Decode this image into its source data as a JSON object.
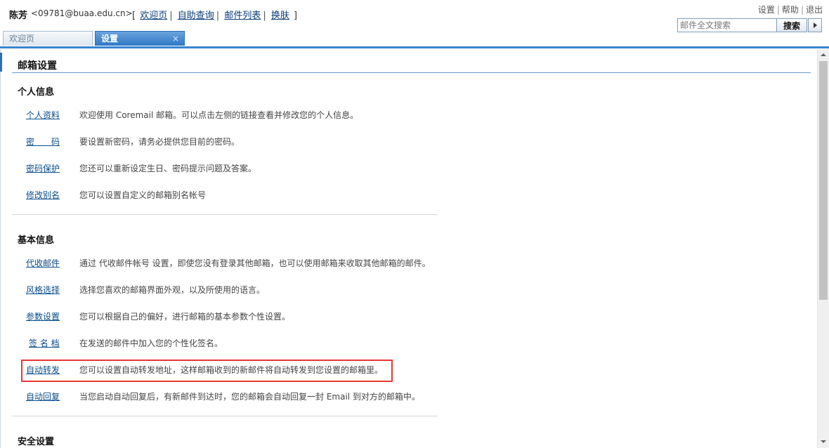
{
  "header": {
    "user_name": "陈芳",
    "user_email": "<09781@buaa.edu.cn>",
    "nav_open": "[",
    "nav_close": "]",
    "nav_links": [
      "欢迎页",
      "自助查询",
      "邮件列表",
      "换肤"
    ],
    "util_links": [
      "设置",
      "帮助",
      "退出"
    ],
    "search": {
      "placeholder": "邮件全文搜索",
      "button_label": "搜索"
    }
  },
  "tabs": [
    {
      "label": "欢迎页",
      "active": false
    },
    {
      "label": "设置",
      "active": true,
      "close_glyph": "×"
    }
  ],
  "page": {
    "title": "邮箱设置",
    "sections": [
      {
        "title": "个人信息",
        "items": [
          {
            "label": "个人资料",
            "description": "欢迎使用 Coremail 邮箱。可以点击左侧的链接查看并修改您的个人信息。"
          },
          {
            "label": "密　　码",
            "description": "要设置新密码，请务必提供您目前的密码。"
          },
          {
            "label": "密码保护",
            "description": "您还可以重新设定生日、密码提示问题及答案。"
          },
          {
            "label": "修改别名",
            "description": "您可以设置自定义的邮箱别名帐号"
          }
        ]
      },
      {
        "title": "基本信息",
        "items": [
          {
            "label": "代收邮件",
            "description": "通过 代收邮件帐号 设置，即使您没有登录其他邮箱，也可以使用邮箱来收取其他邮箱的邮件。"
          },
          {
            "label": "风格选择",
            "description": "选择您喜欢的邮箱界面外观，以及所使用的语言。"
          },
          {
            "label": "参数设置",
            "description": "您可以根据自己的偏好，进行邮箱的基本参数个性设置。"
          },
          {
            "label": "签 名 档",
            "description": "在发送的邮件中加入您的个性化签名。"
          },
          {
            "label": "自动转发",
            "description": "您可以设置自动转发地址，这样邮箱收到的新邮件将自动转发到您设置的邮箱里。",
            "highlighted": true
          },
          {
            "label": "自动回复",
            "description": "当您启动自动回复后，有新邮件到达时，您的邮箱会自动回复一封 Email 到对方的邮箱中。"
          }
        ]
      },
      {
        "title": "安全设置",
        "items": []
      }
    ]
  },
  "colors": {
    "accent": "#3a85d0",
    "link": "#0a4d8c",
    "highlight": "#e53935",
    "tab_active": "#2f78c6"
  },
  "icons": {
    "search_arrow": "play-arrow-icon",
    "tab_close": "close-icon"
  }
}
